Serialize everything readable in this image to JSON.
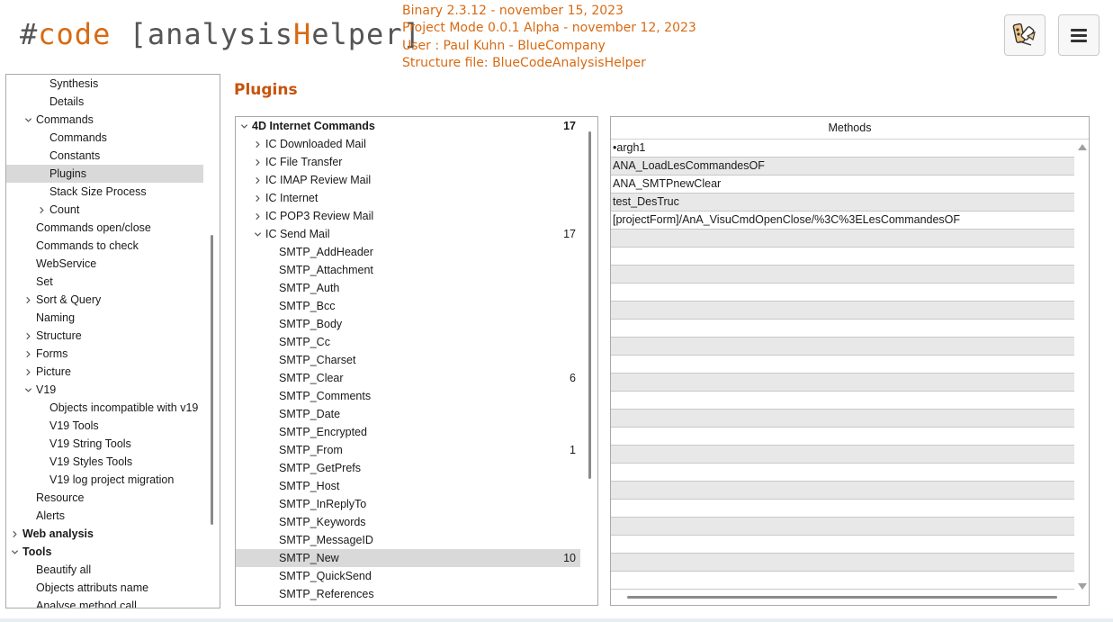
{
  "header": {
    "logo": {
      "hash": "#",
      "code": "code",
      "open": " [",
      "analysis": "analysis",
      "h": "H",
      "elper": "elper",
      "close": "]"
    },
    "info_lines": [
      "Binary 2.3.12 - november 15, 2023",
      "Project Mode 0.0.1 Alpha - november 12, 2023",
      "User : Paul Kuhn - BlueCompany",
      "Structure file: BlueCodeAnalysisHelper"
    ],
    "tools_icon": "tools-icon",
    "menu_icon": "hamburger-menu-icon"
  },
  "sidebar": {
    "items": [
      {
        "label": "Synthesis",
        "level": 2,
        "chevron": "",
        "selected": false,
        "bold": false
      },
      {
        "label": "Details",
        "level": 2,
        "chevron": "",
        "selected": false,
        "bold": false
      },
      {
        "label": "Commands",
        "level": 1,
        "chevron": "down",
        "selected": false,
        "bold": false
      },
      {
        "label": "Commands",
        "level": 2,
        "chevron": "",
        "selected": false,
        "bold": false
      },
      {
        "label": "Constants",
        "level": 2,
        "chevron": "",
        "selected": false,
        "bold": false
      },
      {
        "label": "Plugins",
        "level": 2,
        "chevron": "",
        "selected": true,
        "bold": false
      },
      {
        "label": "Stack Size Process",
        "level": 2,
        "chevron": "",
        "selected": false,
        "bold": false
      },
      {
        "label": "Count",
        "level": 2,
        "chevron": "right",
        "selected": false,
        "bold": false
      },
      {
        "label": "Commands open/close",
        "level": 1,
        "chevron": "",
        "selected": false,
        "bold": false
      },
      {
        "label": "Commands to check",
        "level": 1,
        "chevron": "",
        "selected": false,
        "bold": false
      },
      {
        "label": "WebService",
        "level": 1,
        "chevron": "",
        "selected": false,
        "bold": false
      },
      {
        "label": "Set",
        "level": 1,
        "chevron": "",
        "selected": false,
        "bold": false
      },
      {
        "label": "Sort & Query",
        "level": 1,
        "chevron": "right",
        "selected": false,
        "bold": false
      },
      {
        "label": "Naming",
        "level": 1,
        "chevron": "",
        "selected": false,
        "bold": false
      },
      {
        "label": "Structure",
        "level": 1,
        "chevron": "right",
        "selected": false,
        "bold": false
      },
      {
        "label": "Forms",
        "level": 1,
        "chevron": "right",
        "selected": false,
        "bold": false
      },
      {
        "label": "Picture",
        "level": 1,
        "chevron": "right",
        "selected": false,
        "bold": false
      },
      {
        "label": "V19",
        "level": 1,
        "chevron": "down",
        "selected": false,
        "bold": false
      },
      {
        "label": "Objects incompatible with v19",
        "level": 2,
        "chevron": "",
        "selected": false,
        "bold": false
      },
      {
        "label": "V19 Tools",
        "level": 2,
        "chevron": "",
        "selected": false,
        "bold": false
      },
      {
        "label": "V19 String Tools",
        "level": 2,
        "chevron": "",
        "selected": false,
        "bold": false
      },
      {
        "label": "V19 Styles Tools",
        "level": 2,
        "chevron": "",
        "selected": false,
        "bold": false
      },
      {
        "label": "V19 log project migration",
        "level": 2,
        "chevron": "",
        "selected": false,
        "bold": false
      },
      {
        "label": "Resource",
        "level": 1,
        "chevron": "",
        "selected": false,
        "bold": false
      },
      {
        "label": "Alerts",
        "level": 1,
        "chevron": "",
        "selected": false,
        "bold": false
      },
      {
        "label": "Web analysis",
        "level": 0,
        "chevron": "right",
        "selected": false,
        "bold": true
      },
      {
        "label": "Tools",
        "level": 0,
        "chevron": "down",
        "selected": false,
        "bold": true
      },
      {
        "label": "Beautify all",
        "level": 1,
        "chevron": "",
        "selected": false,
        "bold": false
      },
      {
        "label": "Objects attributs name",
        "level": 1,
        "chevron": "",
        "selected": false,
        "bold": false
      },
      {
        "label": "Analyse method call",
        "level": 1,
        "chevron": "",
        "selected": false,
        "bold": false
      }
    ]
  },
  "main": {
    "title": "Plugins",
    "tree": [
      {
        "label": "4D Internet Commands",
        "count": "17",
        "level": 0,
        "chevron": "down",
        "bold": true,
        "selected": false
      },
      {
        "label": "IC Downloaded Mail",
        "count": "",
        "level": 1,
        "chevron": "right",
        "bold": false,
        "selected": false
      },
      {
        "label": "IC File Transfer",
        "count": "",
        "level": 1,
        "chevron": "right",
        "bold": false,
        "selected": false
      },
      {
        "label": "IC IMAP Review Mail",
        "count": "",
        "level": 1,
        "chevron": "right",
        "bold": false,
        "selected": false
      },
      {
        "label": "IC Internet",
        "count": "",
        "level": 1,
        "chevron": "right",
        "bold": false,
        "selected": false
      },
      {
        "label": "IC POP3 Review Mail",
        "count": "",
        "level": 1,
        "chevron": "right",
        "bold": false,
        "selected": false
      },
      {
        "label": "IC Send Mail",
        "count": "17",
        "level": 1,
        "chevron": "down",
        "bold": false,
        "selected": false
      },
      {
        "label": "SMTP_AddHeader",
        "count": "",
        "level": 2,
        "chevron": "",
        "bold": false,
        "selected": false
      },
      {
        "label": "SMTP_Attachment",
        "count": "",
        "level": 2,
        "chevron": "",
        "bold": false,
        "selected": false
      },
      {
        "label": "SMTP_Auth",
        "count": "",
        "level": 2,
        "chevron": "",
        "bold": false,
        "selected": false
      },
      {
        "label": "SMTP_Bcc",
        "count": "",
        "level": 2,
        "chevron": "",
        "bold": false,
        "selected": false
      },
      {
        "label": "SMTP_Body",
        "count": "",
        "level": 2,
        "chevron": "",
        "bold": false,
        "selected": false
      },
      {
        "label": "SMTP_Cc",
        "count": "",
        "level": 2,
        "chevron": "",
        "bold": false,
        "selected": false
      },
      {
        "label": "SMTP_Charset",
        "count": "",
        "level": 2,
        "chevron": "",
        "bold": false,
        "selected": false
      },
      {
        "label": "SMTP_Clear",
        "count": "6",
        "level": 2,
        "chevron": "",
        "bold": false,
        "selected": false
      },
      {
        "label": "SMTP_Comments",
        "count": "",
        "level": 2,
        "chevron": "",
        "bold": false,
        "selected": false
      },
      {
        "label": "SMTP_Date",
        "count": "",
        "level": 2,
        "chevron": "",
        "bold": false,
        "selected": false
      },
      {
        "label": "SMTP_Encrypted",
        "count": "",
        "level": 2,
        "chevron": "",
        "bold": false,
        "selected": false
      },
      {
        "label": "SMTP_From",
        "count": "1",
        "level": 2,
        "chevron": "",
        "bold": false,
        "selected": false
      },
      {
        "label": "SMTP_GetPrefs",
        "count": "",
        "level": 2,
        "chevron": "",
        "bold": false,
        "selected": false
      },
      {
        "label": "SMTP_Host",
        "count": "",
        "level": 2,
        "chevron": "",
        "bold": false,
        "selected": false
      },
      {
        "label": "SMTP_InReplyTo",
        "count": "",
        "level": 2,
        "chevron": "",
        "bold": false,
        "selected": false
      },
      {
        "label": "SMTP_Keywords",
        "count": "",
        "level": 2,
        "chevron": "",
        "bold": false,
        "selected": false
      },
      {
        "label": "SMTP_MessageID",
        "count": "",
        "level": 2,
        "chevron": "",
        "bold": false,
        "selected": false
      },
      {
        "label": "SMTP_New",
        "count": "10",
        "level": 2,
        "chevron": "",
        "bold": false,
        "selected": true
      },
      {
        "label": "SMTP_QuickSend",
        "count": "",
        "level": 2,
        "chevron": "",
        "bold": false,
        "selected": false
      },
      {
        "label": "SMTP_References",
        "count": "",
        "level": 2,
        "chevron": "",
        "bold": false,
        "selected": false
      }
    ],
    "methods": {
      "header": "Methods",
      "rows": [
        "•argh1",
        "ANA_LoadLesCommandesOF",
        "ANA_SMTPnewClear",
        "test_DesTruc",
        "[projectForm]/AnA_VisuCmdOpenClose/%3C%3ELesCommandesOF",
        "",
        "",
        "",
        "",
        "",
        "",
        "",
        "",
        "",
        "",
        "",
        "",
        "",
        "",
        "",
        "",
        "",
        "",
        "",
        ""
      ]
    }
  }
}
